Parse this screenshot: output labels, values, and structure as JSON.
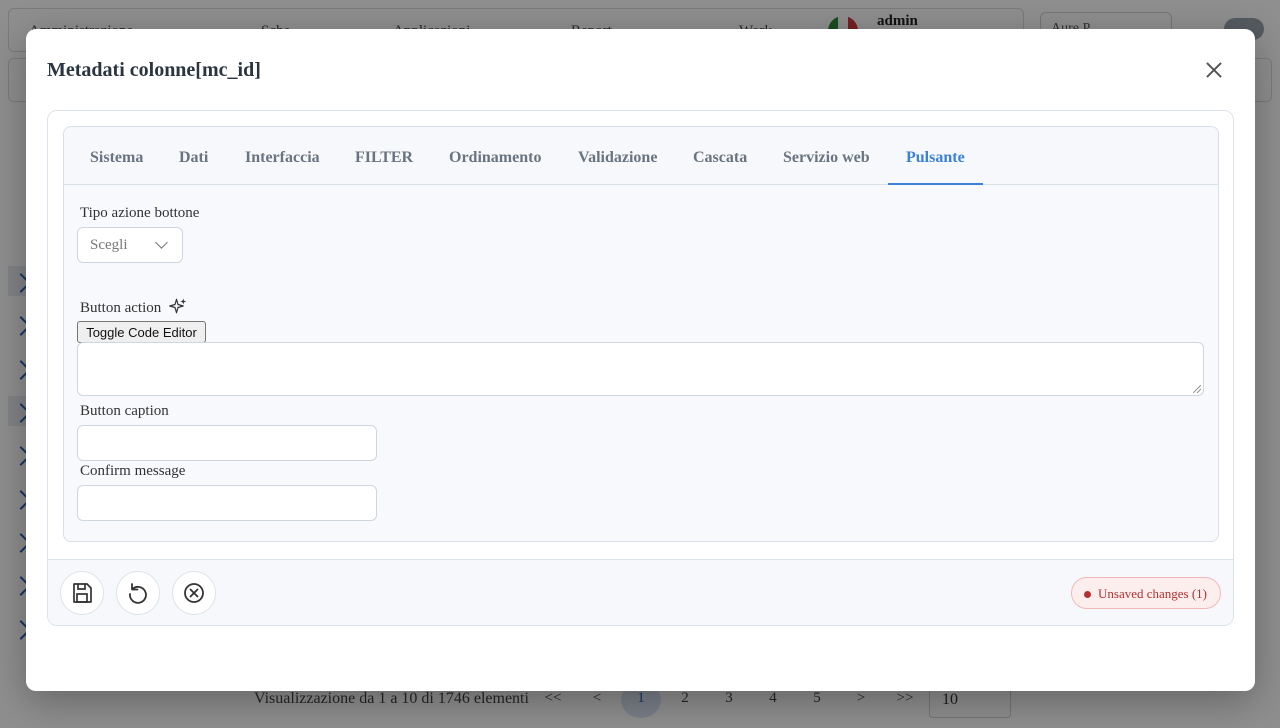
{
  "background": {
    "topbar": [
      "Amministrazione",
      "Sche",
      "Applicazioni",
      "Report",
      "Work"
    ],
    "user": "admin",
    "top_select": "Aure P",
    "pager": {
      "summary": "Visualizzazione da 1 a 10 di 1746 elementi",
      "first": "<<",
      "prev": "<",
      "pages": [
        "1",
        "2",
        "3",
        "4",
        "5"
      ],
      "next": ">",
      "last": ">>",
      "page_size": "10"
    }
  },
  "modal": {
    "title": "Metadati colonne[mc_id]",
    "tabs": [
      {
        "label": "Sistema",
        "active": false
      },
      {
        "label": "Dati",
        "active": false
      },
      {
        "label": "Interfaccia",
        "active": false
      },
      {
        "label": "FILTER",
        "active": false
      },
      {
        "label": "Ordinamento",
        "active": false
      },
      {
        "label": "Validazione",
        "active": false
      },
      {
        "label": "Cascata",
        "active": false
      },
      {
        "label": "Servizio web",
        "active": false
      },
      {
        "label": "Pulsante",
        "active": true
      }
    ],
    "form": {
      "tipo_azione_label": "Tipo azione bottone",
      "tipo_azione_value": "Scegli",
      "button_action_label": "Button action",
      "toggle_code_editor": "Toggle Code Editor",
      "button_action_value": "",
      "button_caption_label": "Button caption",
      "button_caption_value": "",
      "confirm_message_label": "Confirm message",
      "confirm_message_value": ""
    },
    "footer": {
      "icons": [
        "save-icon",
        "undo-icon",
        "cancel-circle-icon"
      ],
      "unsaved_badge": "Unsaved changes (1)"
    }
  },
  "colors": {
    "accent": "#3b82d6",
    "badge_text": "#b13232",
    "badge_bg": "#fdeeee"
  }
}
